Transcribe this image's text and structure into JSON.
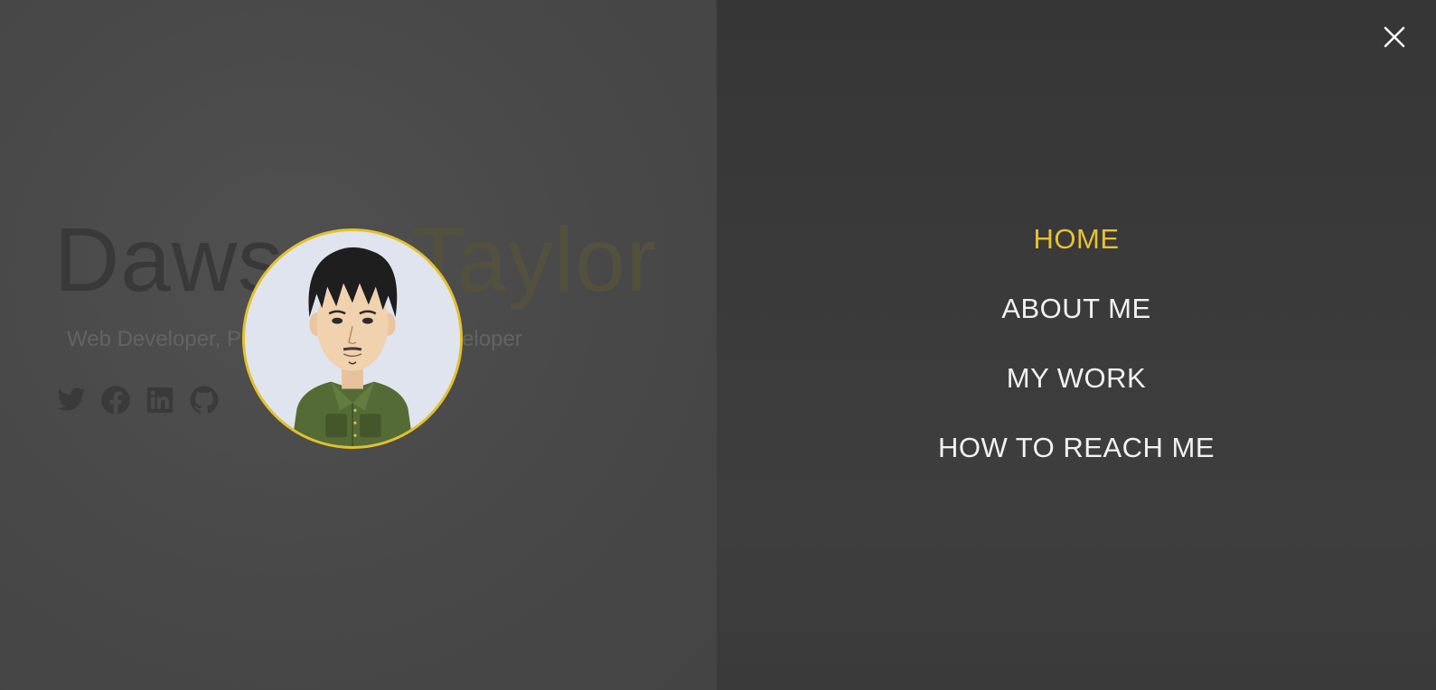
{
  "hero": {
    "first_name": "Dawson",
    "last_name": "Taylor",
    "tagline": "Web Developer, Programmer, Game Developer",
    "social_icons": [
      "twitter-icon",
      "facebook-icon",
      "linkedin-icon",
      "github-icon"
    ]
  },
  "menu": {
    "items": [
      {
        "label": "HOME",
        "active": true
      },
      {
        "label": "ABOUT ME",
        "active": false
      },
      {
        "label": "MY WORK",
        "active": false
      },
      {
        "label": "HOW TO REACH ME",
        "active": false
      }
    ],
    "close_icon": "close-icon"
  },
  "colors": {
    "accent": "#e8c230",
    "menu_text": "#f2f2f2",
    "menu_background": "#3a3a3a",
    "page_overlay": "#4a4a4a"
  }
}
